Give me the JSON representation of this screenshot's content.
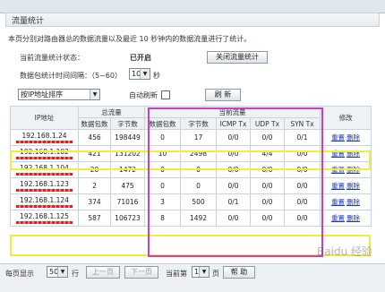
{
  "window_title": "流量统计",
  "description": "本页分别对路由器总的数据流量以及最近 10 秒钟内的数据流量进行了统计。",
  "status": {
    "label": "当前流量统计状态：",
    "value": "已开启",
    "button": "关闭流量统计"
  },
  "interval": {
    "label": "数据包统计时间间隔：（5~60）",
    "value": "10",
    "unit": "秒"
  },
  "sort": {
    "value": "按IP地址排序"
  },
  "auto_refresh": {
    "label": "自动刷新",
    "button": "刷 新"
  },
  "table": {
    "group_total": "总流量",
    "group_current": "当前流量",
    "col_ip": "IP地址",
    "col_modify": "修改",
    "sub_headers": [
      "数据包数",
      "字节数",
      "数据包数",
      "字节数",
      "ICMP Tx",
      "UDP Tx",
      "SYN Tx"
    ],
    "rows": [
      {
        "ip": "192.168.1.24",
        "pk_total": "456",
        "by_total": "198449",
        "pk": "0",
        "by": "17",
        "icmp": "0/0",
        "udp": "0/0",
        "syn": "0/1",
        "reset": "重置",
        "delete": "删除"
      },
      {
        "ip": "192.168.1.102",
        "pk_total": "421",
        "by_total": "131202",
        "pk": "10",
        "by": "2498",
        "icmp": "0/0",
        "udp": "4/4",
        "syn": "0/0",
        "reset": "重置",
        "delete": "删除"
      },
      {
        "ip": "192.168.1.104",
        "pk_total": "20",
        "by_total": "1472",
        "pk": "0",
        "by": "0",
        "icmp": "0/0",
        "udp": "0/0",
        "syn": "0/0",
        "reset": "重置",
        "delete": "删除"
      },
      {
        "ip": "192.168.1.123",
        "pk_total": "2",
        "by_total": "475",
        "pk": "0",
        "by": "0",
        "icmp": "0/0",
        "udp": "0/0",
        "syn": "0/0",
        "reset": "重置",
        "delete": "删除"
      },
      {
        "ip": "192.168.1.124",
        "pk_total": "374",
        "by_total": "71016",
        "pk": "3",
        "by": "500",
        "icmp": "0/1",
        "udp": "0/0",
        "syn": "0/0",
        "reset": "重置",
        "delete": "删除"
      },
      {
        "ip": "192.168.1.125",
        "pk_total": "587",
        "by_total": "106723",
        "pk": "8",
        "by": "1492",
        "icmp": "0/0",
        "udp": "0/0",
        "syn": "0/0",
        "reset": "重置",
        "delete": "删除"
      }
    ]
  },
  "footer": {
    "per_page_label": "每页显示",
    "per_page_value": "50",
    "per_page_unit": "行",
    "prev": "上一页",
    "next": "下一页",
    "page_prefix": "当前第",
    "page_value": "1",
    "page_suffix": "页",
    "help": "帮 助"
  },
  "watermark": "Baidu 经验"
}
